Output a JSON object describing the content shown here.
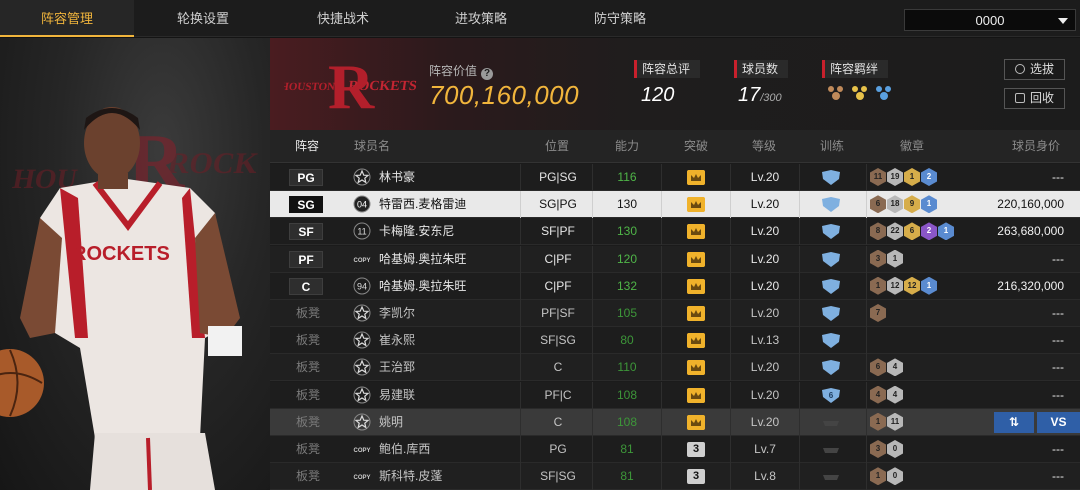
{
  "tabs": [
    "阵容管理",
    "轮换设置",
    "快捷战术",
    "进攻策略",
    "防守策略"
  ],
  "lineup_select": "0000",
  "team_logo_text": "HOUSTON ROCKETS",
  "header": {
    "value_label": "阵容价值",
    "value": "700,160,000",
    "overall_label": "阵容总评",
    "overall": "120",
    "player_count_label": "球员数",
    "player_count": "17",
    "player_count_max": "/300",
    "bond_label": "阵容羁绊",
    "select_btn": "选拔",
    "recycle_btn": "回收"
  },
  "columns": [
    "阵容",
    "球员名",
    "位置",
    "能力",
    "突破",
    "等级",
    "训练",
    "徽章",
    "球员身价"
  ],
  "rows": [
    {
      "slot": "PG",
      "icon": "star",
      "name": "林书豪",
      "position": "PG|SG",
      "ability": "116",
      "level": "Lv.20",
      "train": "shield",
      "badges": [
        [
          "11",
          "brown"
        ],
        [
          "19",
          "grey"
        ],
        [
          "1",
          "gold"
        ],
        [
          "2",
          "blue"
        ]
      ],
      "price": "---"
    },
    {
      "slot": "SG",
      "icon": "number",
      "iconText": "04",
      "name": "特雷西.麦格雷迪",
      "position": "SG|PG",
      "ability": "130",
      "level": "Lv.20",
      "train": "shield",
      "badges": [
        [
          "6",
          "brown"
        ],
        [
          "18",
          "grey"
        ],
        [
          "9",
          "gold"
        ],
        [
          "1",
          "blue"
        ]
      ],
      "price": "220,160,000"
    },
    {
      "slot": "SF",
      "icon": "number",
      "iconText": "11",
      "name": "卡梅隆.安东尼",
      "position": "SF|PF",
      "ability": "130",
      "level": "Lv.20",
      "train": "shield",
      "badges": [
        [
          "8",
          "brown"
        ],
        [
          "22",
          "grey"
        ],
        [
          "6",
          "gold"
        ],
        [
          "2",
          "purple"
        ],
        [
          "1",
          "blue"
        ]
      ],
      "price": "263,680,000"
    },
    {
      "slot": "PF",
      "icon": "copy",
      "iconText": "COPY",
      "name": "哈基姆.奥拉朱旺",
      "position": "C|PF",
      "ability": "120",
      "level": "Lv.20",
      "train": "shield",
      "badges": [
        [
          "3",
          "brown"
        ],
        [
          "1",
          "grey"
        ]
      ],
      "price": "---"
    },
    {
      "slot": "C",
      "icon": "number",
      "iconText": "94",
      "name": "哈基姆.奥拉朱旺",
      "position": "C|PF",
      "ability": "132",
      "level": "Lv.20",
      "train": "shield",
      "badges": [
        [
          "1",
          "brown"
        ],
        [
          "12",
          "grey"
        ],
        [
          "12",
          "gold"
        ],
        [
          "1",
          "blue"
        ]
      ],
      "price": "216,320,000"
    },
    {
      "slot": "板凳",
      "icon": "star",
      "name": "李凯尔",
      "position": "PF|SF",
      "ability": "105",
      "level": "Lv.20",
      "train": "shield",
      "badges": [
        [
          "7",
          "brown"
        ]
      ],
      "price": "---"
    },
    {
      "slot": "板凳",
      "icon": "star",
      "name": "崔永熙",
      "position": "SF|SG",
      "ability": "80",
      "level": "Lv.13",
      "train": "shield",
      "badges": [],
      "price": "---"
    },
    {
      "slot": "板凳",
      "icon": "star",
      "name": "王治郅",
      "position": "C",
      "ability": "110",
      "level": "Lv.20",
      "train": "shield",
      "badges": [
        [
          "6",
          "brown"
        ],
        [
          "4",
          "grey"
        ]
      ],
      "price": "---"
    },
    {
      "slot": "板凳",
      "icon": "star",
      "name": "易建联",
      "position": "PF|C",
      "ability": "108",
      "level": "Lv.20",
      "train": "shield6",
      "badges": [
        [
          "4",
          "brown"
        ],
        [
          "4",
          "grey"
        ]
      ],
      "price": "---"
    },
    {
      "slot": "板凳",
      "icon": "star",
      "name": "姚明",
      "position": "C",
      "ability": "108",
      "level": "Lv.20",
      "train": "dash",
      "badges": [
        [
          "1",
          "brown"
        ],
        [
          "11",
          "grey"
        ]
      ],
      "price": ""
    },
    {
      "slot": "板凳",
      "icon": "copy",
      "iconText": "COPY",
      "name": "鲍伯.库西",
      "position": "PG",
      "ability": "81",
      "level": "Lv.7",
      "train": "dash",
      "badges": [
        [
          "3",
          "brown"
        ],
        [
          "0",
          "grey"
        ]
      ],
      "price": "---"
    },
    {
      "slot": "板凳",
      "icon": "copy",
      "iconText": "COPY",
      "name": "斯科特.皮蓬",
      "position": "SF|SG",
      "ability": "81",
      "level": "Lv.8",
      "train": "dash",
      "badges": [
        [
          "1",
          "brown"
        ],
        [
          "0",
          "grey"
        ]
      ],
      "price": "---"
    }
  ],
  "row_actions": {
    "swap": "⇅",
    "vs": "VS"
  },
  "colors": {
    "accent": "#f1b53c",
    "ability_green": "#4fb548",
    "team_red": "#c8202c",
    "action_blue": "#2f5fa7"
  }
}
